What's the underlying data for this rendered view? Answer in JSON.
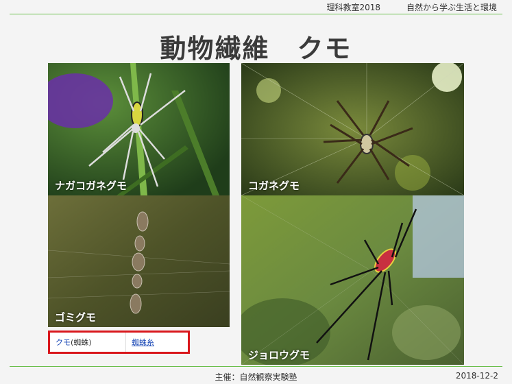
{
  "header": {
    "subject": "理科教室2018",
    "course": "自然から学ぶ生活と環境"
  },
  "title": "動物繊維　クモ",
  "photos": [
    {
      "caption": "ナガコガネグモ"
    },
    {
      "caption": "コガネグモ"
    },
    {
      "caption": "ゴミグモ"
    },
    {
      "caption": "ジョロウグモ"
    }
  ],
  "links": {
    "spider_link": "クモ",
    "spider_kanji": "(蜘蛛)",
    "silk_link": "蜘蛛糸"
  },
  "footer": {
    "organizer": "主催：自然観察実験塾",
    "date": "2018-12-2"
  }
}
